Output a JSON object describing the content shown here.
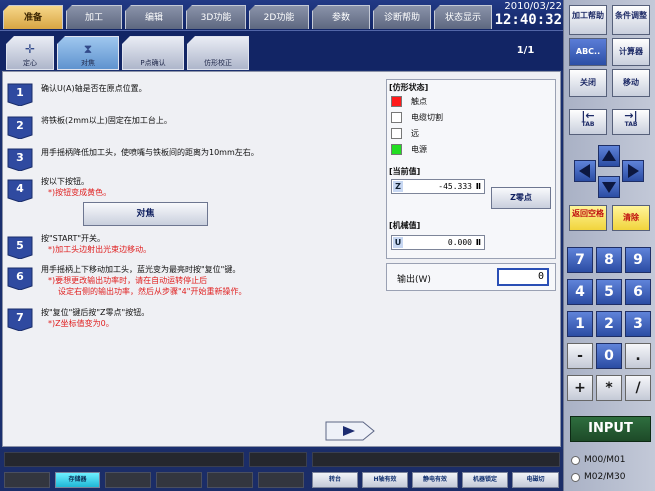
{
  "top_tabs": [
    "准备",
    "加工",
    "编辑",
    "3D功能",
    "2D功能",
    "参数",
    "诊断帮助",
    "状态显示"
  ],
  "datetime": {
    "date": "2010/03/22",
    "time": "12:40:32"
  },
  "sub_tabs": [
    {
      "label": "定心",
      "icon": "crosshair-icon"
    },
    {
      "label": "对焦",
      "icon": "focus-icon"
    },
    {
      "label": "P点确认",
      "icon": "point-icon"
    },
    {
      "label": "仿形校正",
      "icon": "profile-icon"
    }
  ],
  "page_indicator": "1/1",
  "steps": [
    {
      "num": "1",
      "lines": [
        {
          "text": "确认U(A)轴是否在原点位置。",
          "red": false
        }
      ]
    },
    {
      "num": "2",
      "lines": [
        {
          "text": "将铁板(2mm以上)固定在加工台上。",
          "red": false
        }
      ]
    },
    {
      "num": "3",
      "lines": [
        {
          "text": "用手摇柄降低加工头，使喷嘴与铁板间的距离为10mm左右。",
          "red": false
        }
      ]
    },
    {
      "num": "4",
      "lines": [
        {
          "text": "按以下按钮。",
          "red": false
        },
        {
          "text": "*)按钮变成黄色。",
          "red": true
        }
      ]
    },
    {
      "num": "5",
      "lines": [
        {
          "text": "按\"START\"开关。",
          "red": false
        },
        {
          "text": "*)加工头边射出光束边移动。",
          "red": true
        }
      ]
    },
    {
      "num": "6",
      "lines": [
        {
          "text": "用手摇柄上下移动加工头，蓝光变为最亮时按\"复位\"键。",
          "red": false
        },
        {
          "text": "*)要想更改输出功率时，请在自动运转停止后",
          "red": true
        },
        {
          "text": "设定右侧的输出功率，然后从步骤\"4\"开始重新操作。",
          "red": true
        }
      ]
    },
    {
      "num": "7",
      "lines": [
        {
          "text": "按\"复位\"键后按\"Z零点\"按钮。",
          "red": false
        },
        {
          "text": "*)Z坐标值变为0。",
          "red": true
        }
      ]
    }
  ],
  "align_button": "对焦",
  "status_panel": {
    "title": "[仿形状态]",
    "lamps": [
      {
        "label": "触点",
        "color": "#ff1a1a"
      },
      {
        "label": "电缆切割",
        "color": "#ffffff"
      },
      {
        "label": "远",
        "color": "#ffffff"
      },
      {
        "label": "电源",
        "color": "#22dd22"
      }
    ],
    "current_title": "[当前值]",
    "current": {
      "axis": "Z",
      "value": "-45.333",
      "unit": "Ⅱ"
    },
    "zzero_button": "Z零点",
    "machine_title": "[机械值]",
    "machine": {
      "axis": "U",
      "value": "0.000",
      "unit": "Ⅱ"
    }
  },
  "output": {
    "label": "输出(W)",
    "value": "0"
  },
  "bottom_buttons": {
    "storage": "存储器",
    "b1": "转台",
    "b2": "H轴有效",
    "b3": "静电有效",
    "b4": "机器锁定",
    "b5": "电磁切"
  },
  "right_keys": {
    "machining_help": "加工帮助",
    "condition_adjust": "条件调整",
    "abc": "ABC..",
    "calculator": "计算器",
    "close": "关闭",
    "move": "移动",
    "tab_left": "TAB",
    "tab_right": "TAB",
    "return_blank": "返回空格",
    "clear": "清除",
    "digits": [
      "7",
      "8",
      "9",
      "4",
      "5",
      "6",
      "1",
      "2",
      "3",
      "-",
      "0",
      ".",
      "+",
      "*",
      "/"
    ],
    "input": "INPUT",
    "m1": "M00/M01",
    "m2": "M02/M30"
  }
}
